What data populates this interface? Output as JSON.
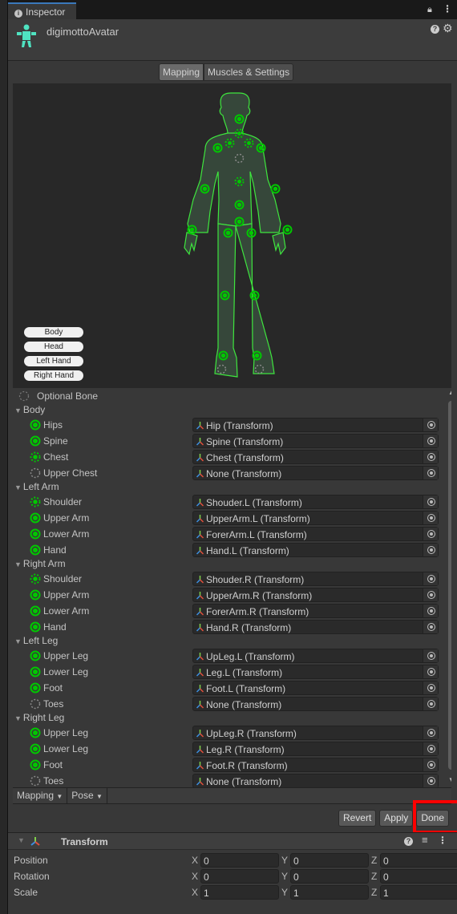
{
  "window": {
    "tab_label": "Inspector",
    "tab_icon": "info-icon",
    "lock_icon": "lock-icon",
    "menu_icon": "kebab-menu-icon"
  },
  "header": {
    "title": "digimottoAvatar",
    "icon": "avatar-icon",
    "help_icon": "help-icon",
    "settings_icon": "gear-icon"
  },
  "mode_tabs": [
    {
      "label": "Mapping",
      "selected": true
    },
    {
      "label": "Muscles & Settings",
      "selected": false
    }
  ],
  "body_parts": [
    "Body",
    "Head",
    "Left Hand",
    "Right Hand"
  ],
  "colors": {
    "mapped": "#00c800",
    "optional_missing": "#8a8a8a",
    "figure_outline": "#3ee63e",
    "highlight_box": "#ff0000",
    "avatar_icon": "#4fe3c1"
  },
  "legend": {
    "label": "Optional Bone"
  },
  "groups": [
    {
      "name": "Body",
      "bones": [
        {
          "label": "Hips",
          "value": "Hip (Transform)",
          "status": "mapped"
        },
        {
          "label": "Spine",
          "value": "Spine (Transform)",
          "status": "mapped"
        },
        {
          "label": "Chest",
          "value": "Chest (Transform)",
          "status": "mapped-optional"
        },
        {
          "label": "Upper Chest",
          "value": "None (Transform)",
          "status": "missing-optional"
        }
      ]
    },
    {
      "name": "Left Arm",
      "bones": [
        {
          "label": "Shoulder",
          "value": "Shouder.L (Transform)",
          "status": "mapped-optional"
        },
        {
          "label": "Upper Arm",
          "value": "UpperArm.L (Transform)",
          "status": "mapped"
        },
        {
          "label": "Lower Arm",
          "value": "ForerArm.L (Transform)",
          "status": "mapped"
        },
        {
          "label": "Hand",
          "value": "Hand.L (Transform)",
          "status": "mapped"
        }
      ]
    },
    {
      "name": "Right Arm",
      "bones": [
        {
          "label": "Shoulder",
          "value": "Shouder.R (Transform)",
          "status": "mapped-optional"
        },
        {
          "label": "Upper Arm",
          "value": "UpperArm.R (Transform)",
          "status": "mapped"
        },
        {
          "label": "Lower Arm",
          "value": "ForerArm.R (Transform)",
          "status": "mapped"
        },
        {
          "label": "Hand",
          "value": "Hand.R (Transform)",
          "status": "mapped"
        }
      ]
    },
    {
      "name": "Left Leg",
      "bones": [
        {
          "label": "Upper Leg",
          "value": "UpLeg.L (Transform)",
          "status": "mapped"
        },
        {
          "label": "Lower Leg",
          "value": "Leg.L (Transform)",
          "status": "mapped"
        },
        {
          "label": "Foot",
          "value": "Foot.L (Transform)",
          "status": "mapped"
        },
        {
          "label": "Toes",
          "value": "None (Transform)",
          "status": "missing-optional"
        }
      ]
    },
    {
      "name": "Right Leg",
      "bones": [
        {
          "label": "Upper Leg",
          "value": "UpLeg.R (Transform)",
          "status": "mapped"
        },
        {
          "label": "Lower Leg",
          "value": "Leg.R (Transform)",
          "status": "mapped"
        },
        {
          "label": "Foot",
          "value": "Foot.R (Transform)",
          "status": "mapped"
        },
        {
          "label": "Toes",
          "value": "None (Transform)",
          "status": "missing-optional"
        }
      ]
    }
  ],
  "bottom_menus": [
    {
      "label": "Mapping"
    },
    {
      "label": "Pose"
    }
  ],
  "actions": {
    "revert": "Revert",
    "apply": "Apply",
    "done": "Done"
  },
  "transform": {
    "title": "Transform",
    "rows": [
      {
        "label": "Position",
        "x": "0",
        "y": "0",
        "z": "0"
      },
      {
        "label": "Rotation",
        "x": "0",
        "y": "0",
        "z": "0"
      },
      {
        "label": "Scale",
        "x": "1",
        "y": "1",
        "z": "1"
      }
    ]
  }
}
